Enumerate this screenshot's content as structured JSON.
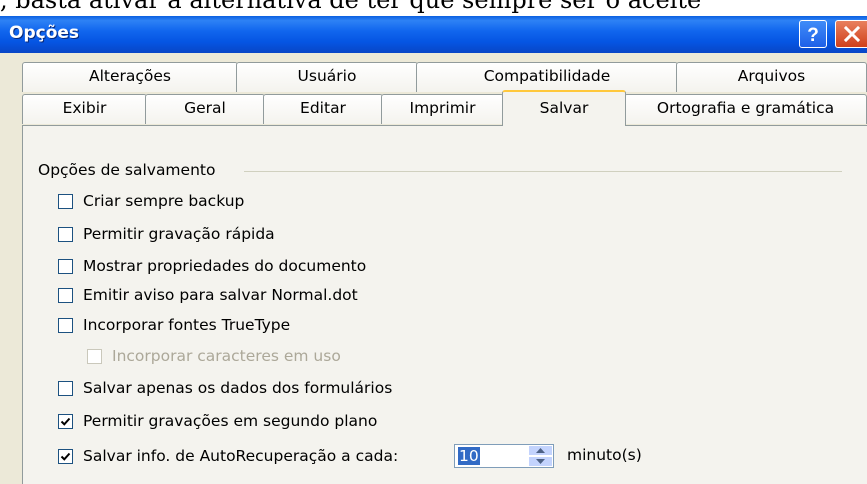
{
  "background_text": ", basta ativar a alternativa de ter que sempre ser o aceite",
  "window": {
    "title": "Opções"
  },
  "tabs_row1": [
    {
      "label": "Alterações"
    },
    {
      "label": "Usuário"
    },
    {
      "label": "Compatibilidade"
    },
    {
      "label": "Arquivos"
    }
  ],
  "tabs_row2": [
    {
      "label": "Exibir"
    },
    {
      "label": "Geral"
    },
    {
      "label": "Editar"
    },
    {
      "label": "Imprimir"
    },
    {
      "label": "Salvar",
      "active": true
    },
    {
      "label": "Ortografia e gramática"
    }
  ],
  "group": {
    "title": "Opções de salvamento"
  },
  "options": [
    {
      "label": "Criar sempre backup",
      "checked": false,
      "enabled": true
    },
    {
      "label": "Permitir gravação rápida",
      "checked": false,
      "enabled": true
    },
    {
      "label": "Mostrar propriedades do documento",
      "checked": false,
      "enabled": true
    },
    {
      "label": "Emitir aviso para salvar Normal.dot",
      "checked": false,
      "enabled": true
    },
    {
      "label": "Incorporar fontes TrueType",
      "checked": false,
      "enabled": true
    },
    {
      "label": "Incorporar caracteres em uso",
      "checked": false,
      "enabled": false
    },
    {
      "label": "Salvar apenas os dados dos formulários",
      "checked": false,
      "enabled": true
    },
    {
      "label": "Permitir gravações em segundo plano",
      "checked": true,
      "enabled": true
    },
    {
      "label": "Salvar info. de AutoRecuperação a cada:",
      "checked": true,
      "enabled": true
    }
  ],
  "autorecover": {
    "value": "10",
    "unit_label": "minuto(s)"
  },
  "colors": {
    "titlebar": "#0555e3",
    "dialog_bg": "#ece9d8",
    "panel_bg": "#f4f3ee",
    "active_tab_accent": "#ffc83c",
    "selection": "#316ac5"
  }
}
